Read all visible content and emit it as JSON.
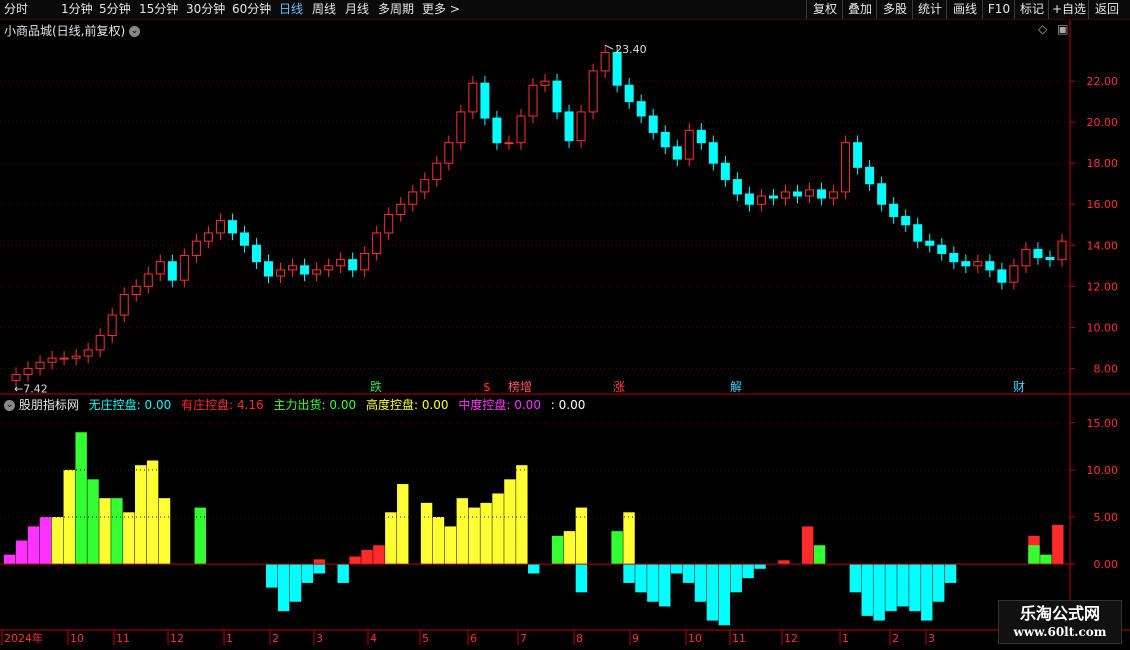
{
  "toolbar": {
    "periods": [
      "分时",
      "1分钟",
      "5分钟",
      "15分钟",
      "30分钟",
      "60分钟",
      "日线",
      "周线",
      "月线",
      "多周期",
      "更多"
    ],
    "active_period": "日线",
    "more_arrow": ">",
    "actions": [
      "复权",
      "叠加",
      "多股",
      "统计",
      "画线",
      "F10",
      "标记",
      "+自选",
      "返回"
    ]
  },
  "main_panel": {
    "title": "小商品城(日线,前复权)",
    "high_label": "23.40",
    "low_label": "7.42",
    "markers": [
      {
        "text": "跌",
        "color": "#29e54a"
      },
      {
        "text": "$",
        "color": "#ff3030"
      },
      {
        "text": "榜增",
        "color": "#ff5a5a"
      },
      {
        "text": "涨",
        "color": "#ff4040"
      },
      {
        "text": "解",
        "color": "#37d4ff"
      },
      {
        "text": "财",
        "color": "#37d4ff"
      }
    ]
  },
  "indicator_panel": {
    "name": "股朋指标网",
    "legend": [
      {
        "label": "无庄控盘:",
        "value": "0.00",
        "color": "#00ffff"
      },
      {
        "label": "有庄控盘:",
        "value": "4.16",
        "color": "#ff2a2a"
      },
      {
        "label": "主力出货:",
        "value": "0.00",
        "color": "#33ff33"
      },
      {
        "label": "高度控盘:",
        "value": "0.00",
        "color": "#ffff33"
      },
      {
        "label": "中度控盘:",
        "value": "0.00",
        "color": "#ff33ff"
      },
      {
        "label": ":",
        "value": "0.00",
        "color": "#ffffff"
      }
    ]
  },
  "x_axis": {
    "labels": [
      "2024年",
      "10",
      "11",
      "12",
      "1",
      "2",
      "3",
      "4",
      "5",
      "6",
      "7",
      "8",
      "9",
      "10",
      "11",
      "12",
      "1",
      "2",
      "3"
    ]
  },
  "watermark": {
    "title": "乐淘公式网",
    "url": "www.60lt.com"
  },
  "colors": {
    "up": "#ff3030",
    "down": "#00ffff",
    "axis": "#c00000",
    "grid": "#5a0000",
    "background": "#000000"
  },
  "chart_data": [
    {
      "type": "candlestick",
      "title": "小商品城(日线,前复权)",
      "y_ticks": [
        8.0,
        10.0,
        12.0,
        14.0,
        16.0,
        18.0,
        20.0,
        22.0
      ],
      "ylim": [
        6.8,
        24.2
      ],
      "close_series": [
        7.42,
        7.7,
        8.0,
        8.3,
        8.5,
        8.5,
        8.6,
        8.9,
        9.6,
        10.6,
        11.6,
        12.0,
        12.6,
        13.2,
        12.3,
        13.5,
        14.2,
        14.6,
        15.2,
        14.6,
        14.0,
        13.2,
        12.5,
        12.8,
        13.0,
        12.6,
        12.8,
        13.0,
        13.3,
        12.8,
        13.6,
        14.6,
        15.5,
        16.0,
        16.6,
        17.2,
        18.0,
        19.0,
        20.5,
        21.9,
        20.2,
        19.0,
        19.0,
        20.3,
        21.8,
        22.0,
        20.5,
        19.1,
        20.5,
        22.5,
        23.4,
        21.8,
        21.0,
        20.3,
        19.5,
        18.8,
        18.2,
        19.6,
        19.0,
        18.0,
        17.2,
        16.5,
        16.0,
        16.4,
        16.3,
        16.6,
        16.4,
        16.7,
        16.3,
        16.6,
        19.0,
        17.8,
        17.0,
        16.0,
        15.4,
        15.0,
        14.2,
        14.0,
        13.6,
        13.2,
        13.0,
        13.2,
        12.8,
        12.2,
        13.0,
        13.8,
        13.4,
        13.3,
        14.2
      ],
      "labels": [
        "23.40",
        "7.42"
      ]
    },
    {
      "type": "bar",
      "title": "股朋指标网",
      "y_ticks": [
        0.0,
        5.0,
        10.0,
        15.0
      ],
      "ylim": [
        -7.0,
        17.0
      ],
      "series": [
        {
          "name": "无庄控盘",
          "color": "#00ffff",
          "values": [
            0,
            0,
            0,
            0,
            0,
            0,
            0,
            0,
            0,
            0,
            0,
            0,
            0,
            0,
            0,
            0,
            0,
            0,
            0,
            0,
            0,
            0,
            -2.5,
            -5.0,
            -4.0,
            -2.0,
            -1.0,
            0,
            -2.0,
            0,
            0,
            0,
            0,
            0,
            0,
            0,
            0,
            0,
            0,
            0,
            0,
            0,
            0,
            0,
            -1.0,
            0,
            0,
            0,
            -3.0,
            0,
            0,
            0,
            -2.0,
            -3.0,
            -4.0,
            -4.5,
            -1.0,
            -2.0,
            -4.0,
            -6.0,
            -6.5,
            -3.0,
            -1.5,
            -0.5,
            0,
            0,
            0,
            0,
            0,
            0,
            0,
            -3.0,
            -5.5,
            -6.0,
            -5.0,
            -4.5,
            -5.0,
            -6.0,
            -4.0,
            -2.0,
            0,
            0,
            0,
            0,
            0,
            0,
            0,
            0,
            0
          ]
        },
        {
          "name": "有庄控盘",
          "color": "#ff2a2a",
          "values": [
            0,
            0,
            0,
            0,
            0,
            0,
            0,
            0,
            0,
            0,
            0,
            0,
            0,
            0,
            0,
            0,
            0,
            0,
            0,
            0,
            0,
            0,
            0,
            0,
            0,
            0,
            0.5,
            0,
            0,
            0.8,
            1.5,
            2.0,
            0,
            0,
            0,
            0,
            0,
            0,
            0,
            0,
            0,
            0,
            0,
            0,
            0,
            0,
            0,
            0,
            0,
            0,
            0,
            0,
            0,
            0,
            0,
            0,
            0,
            0,
            0,
            0,
            0,
            0,
            0,
            0,
            0,
            0.4,
            0,
            4.0,
            0,
            0,
            0,
            0,
            0,
            0,
            0,
            0,
            0,
            0,
            0,
            0,
            0,
            0,
            0,
            0,
            0,
            0,
            3.0,
            0,
            4.16
          ]
        },
        {
          "name": "主力出货",
          "color": "#33ff33",
          "values": [
            0,
            0,
            0,
            0,
            0,
            4.0,
            14.0,
            9.0,
            0,
            7.0,
            0,
            0,
            0,
            0,
            0,
            0,
            6.0,
            0,
            0,
            0,
            0,
            0,
            0,
            0,
            0,
            0,
            0,
            0,
            0,
            0,
            0,
            0,
            0,
            0,
            0,
            0,
            0,
            0,
            0,
            0,
            0,
            0,
            0,
            0,
            0,
            0,
            3.0,
            0,
            0,
            0,
            0,
            3.5,
            0,
            0,
            0,
            0,
            0,
            0,
            0,
            0,
            0,
            0,
            0,
            0,
            0,
            0,
            0,
            0,
            2.0,
            0,
            0,
            0,
            0,
            0,
            0,
            0,
            0,
            0,
            0,
            0,
            0,
            0,
            0,
            0,
            0,
            0,
            2.0,
            1.0,
            0
          ]
        },
        {
          "name": "高度控盘",
          "color": "#ffff33",
          "values": [
            0,
            0,
            0,
            0,
            5.0,
            10.0,
            0,
            0,
            7.0,
            0,
            5.5,
            10.5,
            11.0,
            7.0,
            0,
            0,
            0,
            0,
            0,
            0,
            0,
            0,
            0,
            0,
            0,
            0,
            0,
            0,
            0,
            0,
            0,
            0,
            5.5,
            8.5,
            0,
            6.5,
            5.0,
            4.0,
            7.0,
            6.0,
            6.5,
            7.5,
            9.0,
            10.5,
            0,
            0,
            0,
            3.5,
            6.0,
            0,
            0,
            0,
            5.5,
            0,
            0,
            0,
            0,
            0,
            0,
            0,
            0,
            0,
            0,
            0,
            0,
            0,
            0,
            0,
            0,
            0,
            0,
            0,
            0,
            0,
            0,
            0,
            0,
            0,
            0,
            0,
            0,
            0,
            0,
            0,
            0,
            0,
            0,
            0,
            0
          ]
        },
        {
          "name": "中度控盘",
          "color": "#ff33ff",
          "values": [
            1.0,
            2.5,
            4.0,
            5.0,
            0,
            0,
            0,
            0,
            0,
            0,
            0,
            0,
            0,
            0,
            0,
            0,
            0,
            0,
            0,
            0,
            0,
            0,
            0,
            0,
            0,
            0,
            0,
            0,
            0,
            0,
            0,
            0,
            0,
            0,
            0,
            0,
            0,
            0,
            0,
            0,
            0,
            0,
            0,
            0,
            0,
            0,
            0,
            0,
            0,
            0,
            0,
            0,
            0,
            0,
            0,
            0,
            0,
            0,
            0,
            0,
            0,
            0,
            0,
            0,
            0,
            0,
            0,
            0,
            0,
            0,
            0,
            0,
            0,
            0,
            0,
            0,
            0,
            0,
            0,
            0,
            0,
            0,
            0,
            0,
            0,
            0,
            0,
            0,
            0
          ]
        }
      ]
    }
  ]
}
